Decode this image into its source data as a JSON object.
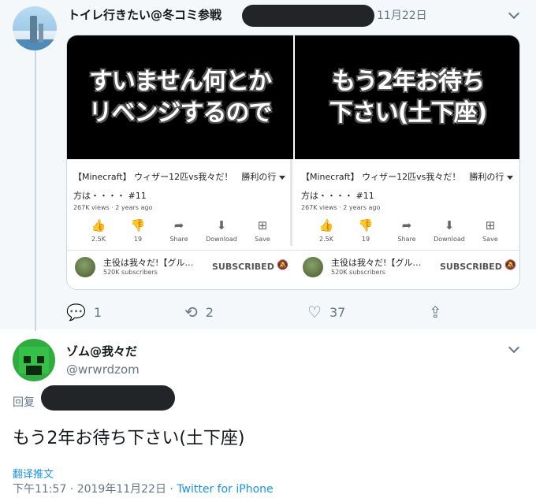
{
  "tweet1": {
    "author_name": "トイレ行きたい@冬コミ参戦",
    "date": "11月22日",
    "media": [
      {
        "video_lines": [
          "すいません何とか",
          "リベンジするので"
        ],
        "title": "【Minecraft】 ウィザー12匹vs我々だ！　勝利の行方は・・・・ #11",
        "views": "267K views · 2 years ago",
        "actions": [
          {
            "icon": "thumbs-up-icon",
            "label": "2.5K"
          },
          {
            "icon": "thumbs-down-icon",
            "label": "19"
          },
          {
            "icon": "share-icon",
            "label": "Share"
          },
          {
            "icon": "download-icon",
            "label": "Download"
          },
          {
            "icon": "save-icon",
            "label": "Save"
          }
        ],
        "channel_name": "主役は我々だ!【グル…",
        "subscribers": "520K subscribers",
        "subscribed_label": "SUBSCRIBED"
      },
      {
        "video_lines": [
          "もう2年お待ち",
          "下さい(土下座)"
        ],
        "title": "【Minecraft】 ウィザー12匹vs我々だ！　勝利の行方は・・・・ #11",
        "views": "267K views · 2 years ago",
        "actions": [
          {
            "icon": "thumbs-up-icon",
            "label": "2.5K"
          },
          {
            "icon": "thumbs-down-icon",
            "label": "19"
          },
          {
            "icon": "share-icon",
            "label": "Share"
          },
          {
            "icon": "download-icon",
            "label": "Download"
          },
          {
            "icon": "save-icon",
            "label": "Save"
          }
        ],
        "channel_name": "主役は我々だ!【グル…",
        "subscribers": "520K subscribers",
        "subscribed_label": "SUBSCRIBED"
      }
    ],
    "reply_count": "1",
    "retweet_count": "2",
    "like_count": "37"
  },
  "reply": {
    "author_name": "ゾム@我々だ",
    "handle": "@wrwrdzom",
    "replying_label": "回复",
    "text": "もう2年お待ち下さい(土下座)",
    "translate_label": "翻译推文",
    "timestamp": "下午11:57 · 2019年11月22日 · ",
    "source": "Twitter for iPhone"
  },
  "colors": {
    "link": "#1b95e0",
    "muted": "#657786",
    "thread_bg": "#f5f8fa"
  }
}
